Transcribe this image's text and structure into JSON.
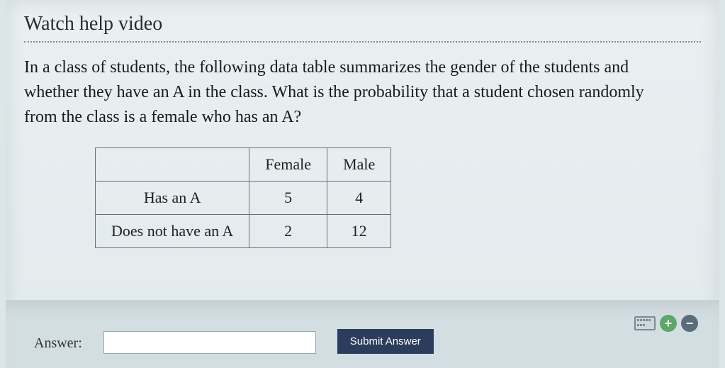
{
  "help_link": "Watch help video",
  "question_text": "In a class of students, the following data table summarizes the gender of the students and whether they have an A in the class. What is the probability that a student chosen randomly from the class is a female who has an A?",
  "table": {
    "col_headers": [
      "Female",
      "Male"
    ],
    "rows": [
      {
        "label": "Has an A",
        "values": [
          "5",
          "4"
        ]
      },
      {
        "label": "Does not have an A",
        "values": [
          "2",
          "12"
        ]
      }
    ]
  },
  "answer": {
    "label": "Answer:",
    "value": ""
  },
  "submit_label": "Submit Answer",
  "chart_data": {
    "type": "table",
    "columns": [
      "",
      "Female",
      "Male"
    ],
    "rows": [
      [
        "Has an A",
        5,
        4
      ],
      [
        "Does not have an A",
        2,
        12
      ]
    ]
  }
}
